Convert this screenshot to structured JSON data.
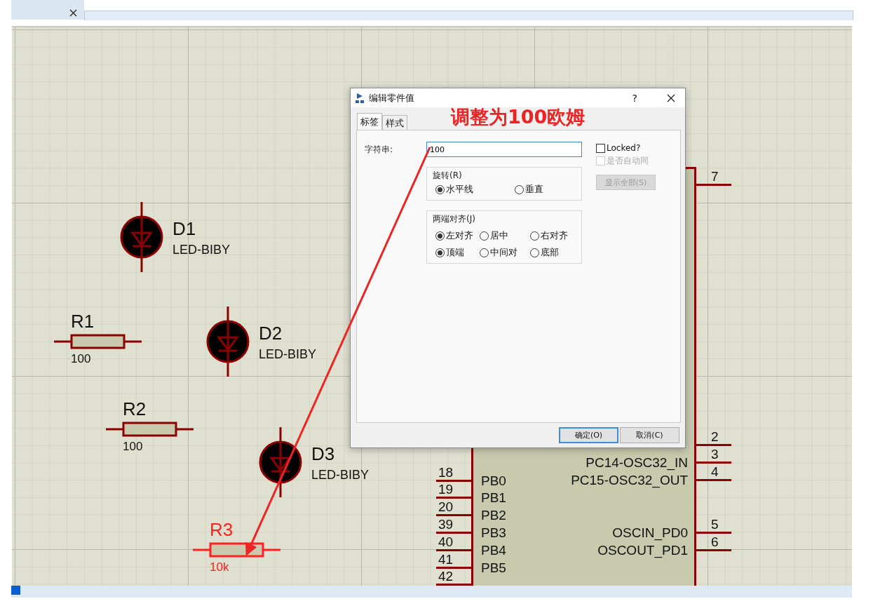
{
  "canvas": {
    "components": [
      {
        "kind": "led",
        "ref": "D1",
        "value": "LED-BIBY",
        "selected": false
      },
      {
        "kind": "resistor",
        "ref": "R1",
        "value": "100",
        "selected": false
      },
      {
        "kind": "led",
        "ref": "D2",
        "value": "LED-BIBY",
        "selected": false
      },
      {
        "kind": "resistor",
        "ref": "R2",
        "value": "100",
        "selected": false
      },
      {
        "kind": "led",
        "ref": "D3",
        "value": "LED-BIBY",
        "selected": false
      },
      {
        "kind": "resistor",
        "ref": "R3",
        "value": "10k",
        "selected": true
      }
    ],
    "chip": {
      "left_pins": [
        {
          "number": "18",
          "label": "PB0"
        },
        {
          "number": "19",
          "label": "PB1"
        },
        {
          "number": "20",
          "label": "PB2"
        },
        {
          "number": "39",
          "label": "PB3"
        },
        {
          "number": "40",
          "label": "PB4"
        },
        {
          "number": "41",
          "label": "PB5"
        },
        {
          "number": "42"
        }
      ],
      "right_pins": [
        {
          "number": "7"
        },
        {
          "number": "2"
        },
        {
          "number": "3",
          "label": "PC14-OSC32_IN"
        },
        {
          "number": "4",
          "label": "PC15-OSC32_OUT"
        },
        {
          "number": "5",
          "label": "OSCIN_PD0"
        },
        {
          "number": "6",
          "label": "OSCOUT_PD1"
        }
      ]
    }
  },
  "dialog": {
    "title": "编辑零件值",
    "help": "?",
    "tabs": [
      {
        "label": "标签",
        "selected": true
      },
      {
        "label": "样式",
        "selected": false
      }
    ],
    "string_label": "字符串:",
    "string_value": "100",
    "locked": {
      "label": "Locked?",
      "checked": false,
      "disabled": false
    },
    "auto": {
      "label": "是否自动同",
      "checked": false,
      "disabled": true
    },
    "show_all": {
      "label": "显示全部(S)",
      "disabled": true
    },
    "rotation": {
      "legend": "旋转(R)",
      "options": [
        {
          "label": "水平线",
          "selected": true
        },
        {
          "label": "垂直",
          "selected": false
        }
      ]
    },
    "justify": {
      "legend": "两端对齐(J)",
      "options": [
        {
          "label": "左对齐",
          "selected": true
        },
        {
          "label": "居中",
          "selected": false
        },
        {
          "label": "右对齐",
          "selected": false
        },
        {
          "label": "顶端",
          "selected": true
        },
        {
          "label": "中间对",
          "selected": false
        },
        {
          "label": "底部",
          "selected": false
        }
      ]
    },
    "buttons": [
      {
        "label": "确定(O)",
        "default": true
      },
      {
        "label": "取消(C)",
        "default": false
      }
    ]
  },
  "annotation": {
    "text": "调整为100欧姆"
  }
}
